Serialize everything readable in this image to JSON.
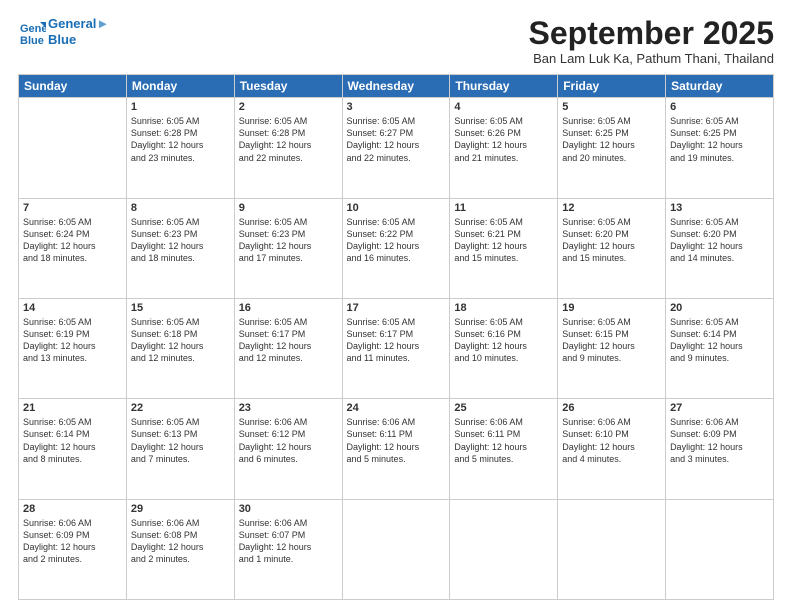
{
  "header": {
    "logo_line1": "General",
    "logo_line2": "Blue",
    "month": "September 2025",
    "location": "Ban Lam Luk Ka, Pathum Thani, Thailand"
  },
  "weekdays": [
    "Sunday",
    "Monday",
    "Tuesday",
    "Wednesday",
    "Thursday",
    "Friday",
    "Saturday"
  ],
  "weeks": [
    [
      {
        "day": "",
        "info": ""
      },
      {
        "day": "1",
        "info": "Sunrise: 6:05 AM\nSunset: 6:28 PM\nDaylight: 12 hours\nand 23 minutes."
      },
      {
        "day": "2",
        "info": "Sunrise: 6:05 AM\nSunset: 6:28 PM\nDaylight: 12 hours\nand 22 minutes."
      },
      {
        "day": "3",
        "info": "Sunrise: 6:05 AM\nSunset: 6:27 PM\nDaylight: 12 hours\nand 22 minutes."
      },
      {
        "day": "4",
        "info": "Sunrise: 6:05 AM\nSunset: 6:26 PM\nDaylight: 12 hours\nand 21 minutes."
      },
      {
        "day": "5",
        "info": "Sunrise: 6:05 AM\nSunset: 6:25 PM\nDaylight: 12 hours\nand 20 minutes."
      },
      {
        "day": "6",
        "info": "Sunrise: 6:05 AM\nSunset: 6:25 PM\nDaylight: 12 hours\nand 19 minutes."
      }
    ],
    [
      {
        "day": "7",
        "info": "Sunrise: 6:05 AM\nSunset: 6:24 PM\nDaylight: 12 hours\nand 18 minutes."
      },
      {
        "day": "8",
        "info": "Sunrise: 6:05 AM\nSunset: 6:23 PM\nDaylight: 12 hours\nand 18 minutes."
      },
      {
        "day": "9",
        "info": "Sunrise: 6:05 AM\nSunset: 6:23 PM\nDaylight: 12 hours\nand 17 minutes."
      },
      {
        "day": "10",
        "info": "Sunrise: 6:05 AM\nSunset: 6:22 PM\nDaylight: 12 hours\nand 16 minutes."
      },
      {
        "day": "11",
        "info": "Sunrise: 6:05 AM\nSunset: 6:21 PM\nDaylight: 12 hours\nand 15 minutes."
      },
      {
        "day": "12",
        "info": "Sunrise: 6:05 AM\nSunset: 6:20 PM\nDaylight: 12 hours\nand 15 minutes."
      },
      {
        "day": "13",
        "info": "Sunrise: 6:05 AM\nSunset: 6:20 PM\nDaylight: 12 hours\nand 14 minutes."
      }
    ],
    [
      {
        "day": "14",
        "info": "Sunrise: 6:05 AM\nSunset: 6:19 PM\nDaylight: 12 hours\nand 13 minutes."
      },
      {
        "day": "15",
        "info": "Sunrise: 6:05 AM\nSunset: 6:18 PM\nDaylight: 12 hours\nand 12 minutes."
      },
      {
        "day": "16",
        "info": "Sunrise: 6:05 AM\nSunset: 6:17 PM\nDaylight: 12 hours\nand 12 minutes."
      },
      {
        "day": "17",
        "info": "Sunrise: 6:05 AM\nSunset: 6:17 PM\nDaylight: 12 hours\nand 11 minutes."
      },
      {
        "day": "18",
        "info": "Sunrise: 6:05 AM\nSunset: 6:16 PM\nDaylight: 12 hours\nand 10 minutes."
      },
      {
        "day": "19",
        "info": "Sunrise: 6:05 AM\nSunset: 6:15 PM\nDaylight: 12 hours\nand 9 minutes."
      },
      {
        "day": "20",
        "info": "Sunrise: 6:05 AM\nSunset: 6:14 PM\nDaylight: 12 hours\nand 9 minutes."
      }
    ],
    [
      {
        "day": "21",
        "info": "Sunrise: 6:05 AM\nSunset: 6:14 PM\nDaylight: 12 hours\nand 8 minutes."
      },
      {
        "day": "22",
        "info": "Sunrise: 6:05 AM\nSunset: 6:13 PM\nDaylight: 12 hours\nand 7 minutes."
      },
      {
        "day": "23",
        "info": "Sunrise: 6:06 AM\nSunset: 6:12 PM\nDaylight: 12 hours\nand 6 minutes."
      },
      {
        "day": "24",
        "info": "Sunrise: 6:06 AM\nSunset: 6:11 PM\nDaylight: 12 hours\nand 5 minutes."
      },
      {
        "day": "25",
        "info": "Sunrise: 6:06 AM\nSunset: 6:11 PM\nDaylight: 12 hours\nand 5 minutes."
      },
      {
        "day": "26",
        "info": "Sunrise: 6:06 AM\nSunset: 6:10 PM\nDaylight: 12 hours\nand 4 minutes."
      },
      {
        "day": "27",
        "info": "Sunrise: 6:06 AM\nSunset: 6:09 PM\nDaylight: 12 hours\nand 3 minutes."
      }
    ],
    [
      {
        "day": "28",
        "info": "Sunrise: 6:06 AM\nSunset: 6:09 PM\nDaylight: 12 hours\nand 2 minutes."
      },
      {
        "day": "29",
        "info": "Sunrise: 6:06 AM\nSunset: 6:08 PM\nDaylight: 12 hours\nand 2 minutes."
      },
      {
        "day": "30",
        "info": "Sunrise: 6:06 AM\nSunset: 6:07 PM\nDaylight: 12 hours\nand 1 minute."
      },
      {
        "day": "",
        "info": ""
      },
      {
        "day": "",
        "info": ""
      },
      {
        "day": "",
        "info": ""
      },
      {
        "day": "",
        "info": ""
      }
    ]
  ]
}
